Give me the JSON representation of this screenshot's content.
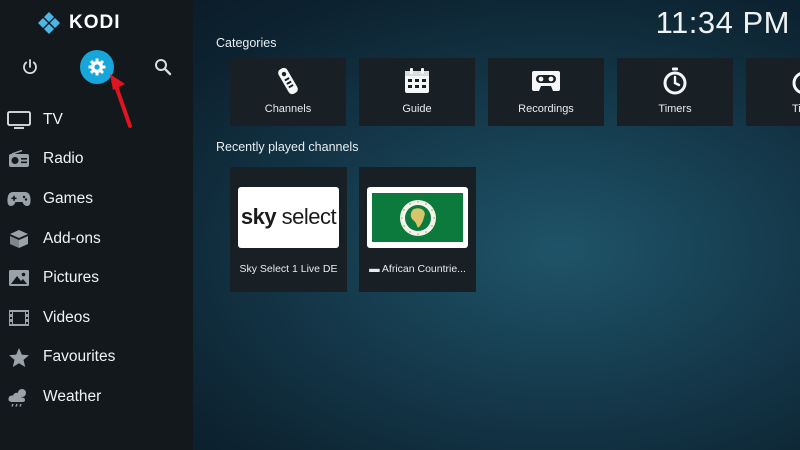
{
  "app": {
    "logo_text": "KODI"
  },
  "clock": "11:34 PM",
  "top_buttons": [
    {
      "name": "power",
      "icon": "power-icon"
    },
    {
      "name": "settings",
      "icon": "gear-icon",
      "highlight_color": "#17a6d9"
    },
    {
      "name": "search",
      "icon": "search-icon"
    }
  ],
  "sidebar": {
    "items": [
      {
        "label": "TV",
        "icon": "tv-icon"
      },
      {
        "label": "Radio",
        "icon": "radio-icon"
      },
      {
        "label": "Games",
        "icon": "gamepad-icon"
      },
      {
        "label": "Add-ons",
        "icon": "box-icon"
      },
      {
        "label": "Pictures",
        "icon": "picture-icon"
      },
      {
        "label": "Videos",
        "icon": "film-icon"
      },
      {
        "label": "Favourites",
        "icon": "star-icon"
      },
      {
        "label": "Weather",
        "icon": "weather-icon"
      }
    ]
  },
  "categories": {
    "title": "Categories",
    "items": [
      {
        "label": "Channels",
        "icon": "remote-icon"
      },
      {
        "label": "Guide",
        "icon": "calendar-icon"
      },
      {
        "label": "Recordings",
        "icon": "cassette-icon"
      },
      {
        "label": "Timers",
        "icon": "stopwatch-icon"
      },
      {
        "label": "Time",
        "icon": "stopwatch-icon"
      }
    ]
  },
  "recent_channels": {
    "title": "Recently played channels",
    "items": [
      {
        "label": "Sky Select 1 Live DE",
        "logo_text_bold": "sky",
        "logo_text": " select"
      },
      {
        "label": "▬ African Countrie..."
      }
    ]
  },
  "colors": {
    "accent": "#17a6d9",
    "annotation": "#e0141e",
    "sidebar": "#13181d",
    "tile": "#181f25"
  }
}
